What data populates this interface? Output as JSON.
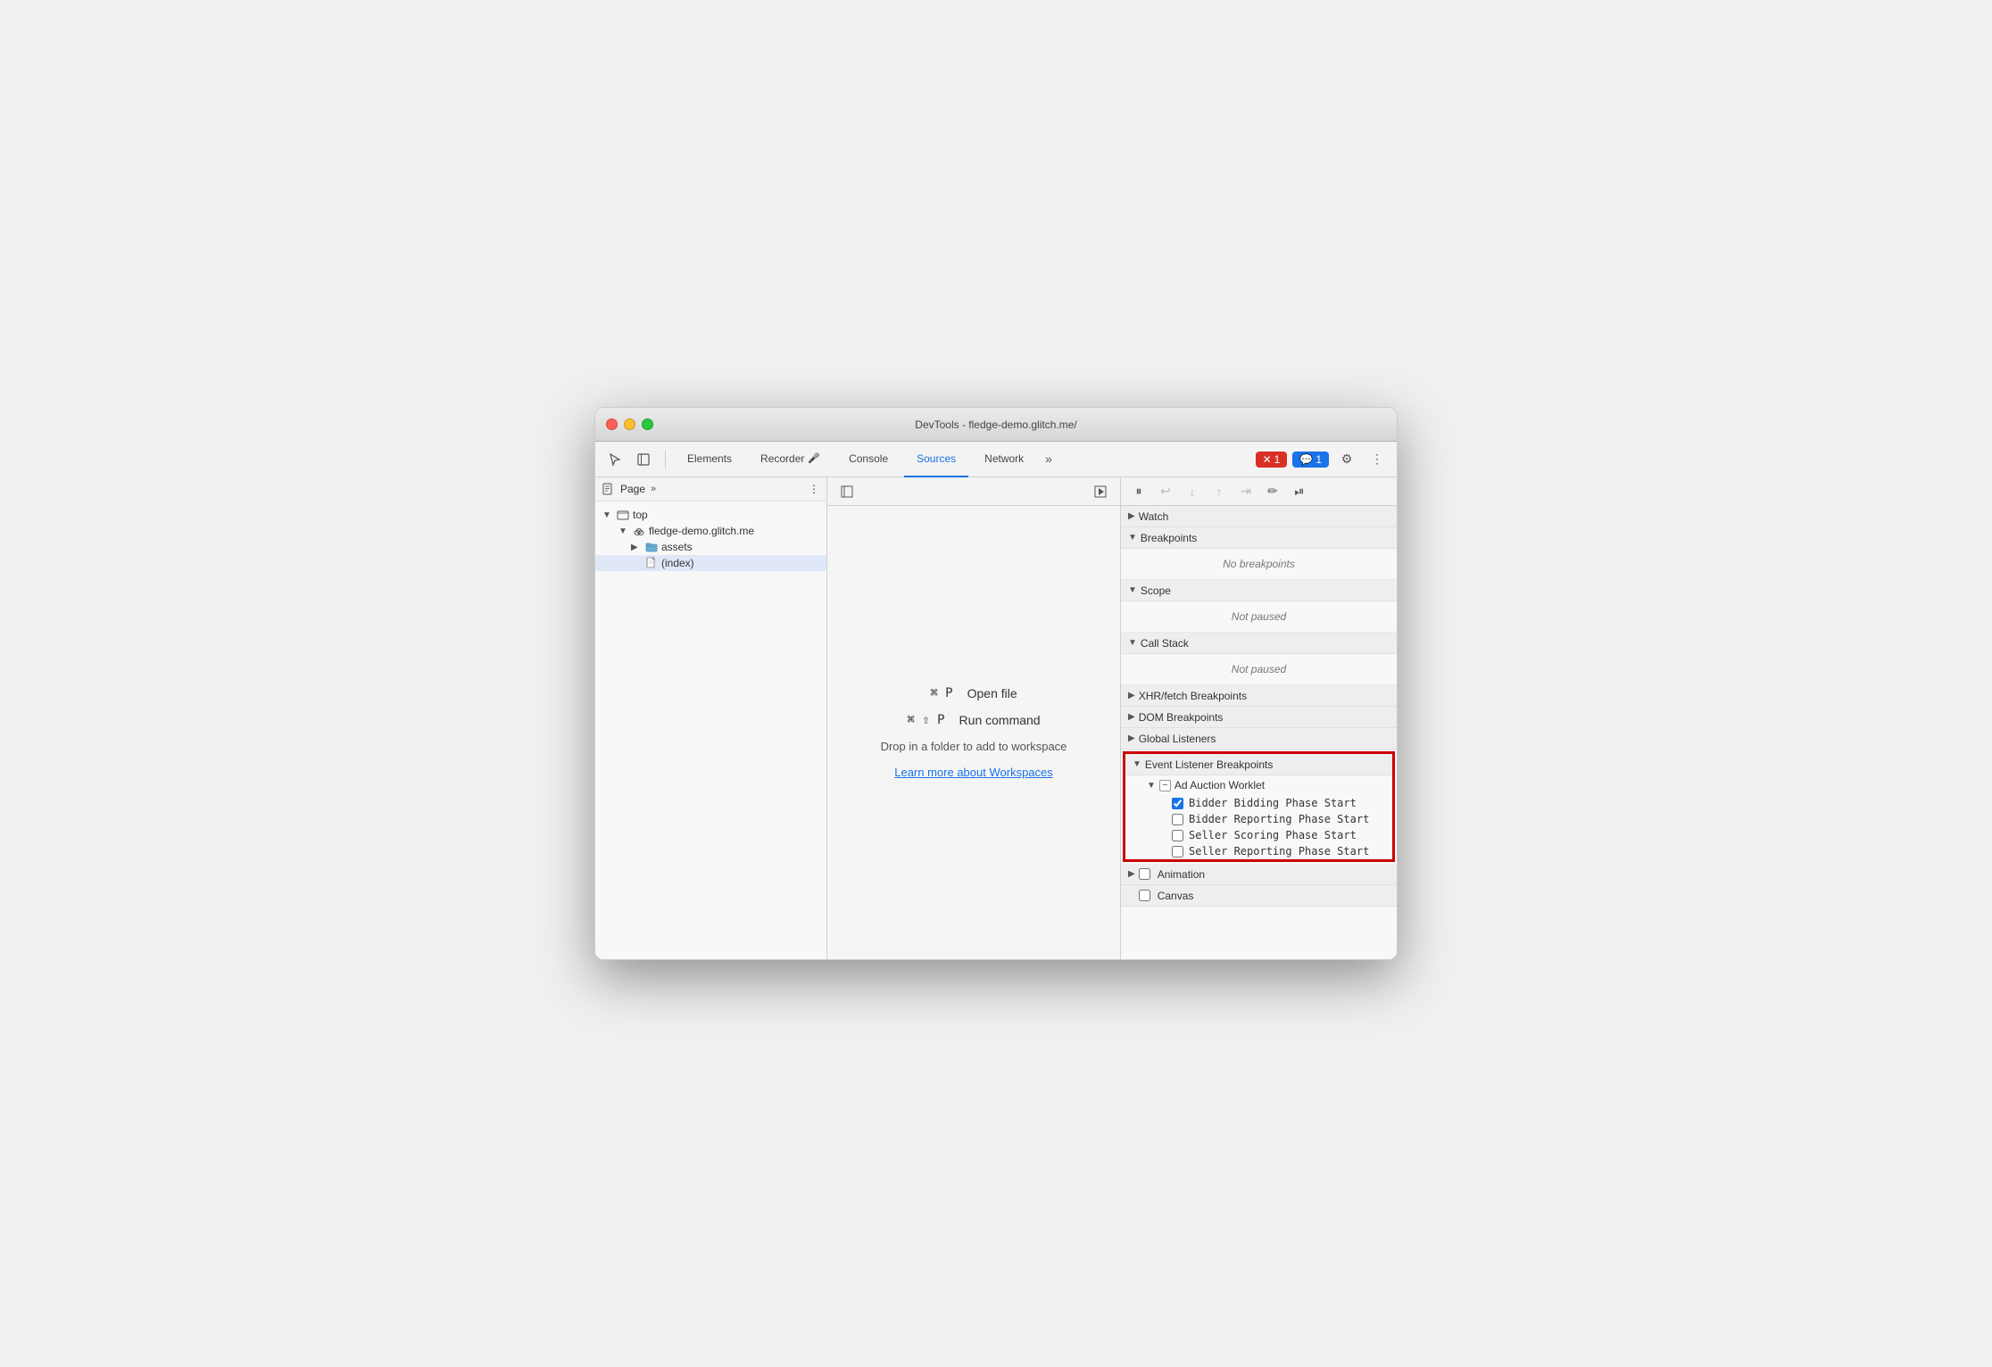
{
  "window": {
    "title": "DevTools - fledge-demo.glitch.me/"
  },
  "toolbar": {
    "tabs": [
      {
        "label": "Elements",
        "active": false
      },
      {
        "label": "Recorder",
        "active": false
      },
      {
        "label": "Console",
        "active": false
      },
      {
        "label": "Sources",
        "active": true
      },
      {
        "label": "Network",
        "active": false
      },
      {
        "label": "»",
        "active": false
      }
    ],
    "error_badge": "1",
    "message_badge": "1"
  },
  "left_panel": {
    "header": "Page",
    "tree": [
      {
        "label": "top",
        "indent": 0,
        "expanded": true,
        "type": "folder"
      },
      {
        "label": "fledge-demo.glitch.me",
        "indent": 1,
        "expanded": true,
        "type": "cloud"
      },
      {
        "label": "assets",
        "indent": 2,
        "expanded": false,
        "type": "folder"
      },
      {
        "label": "(index)",
        "indent": 2,
        "expanded": false,
        "type": "file",
        "selected": true
      }
    ]
  },
  "middle_panel": {
    "shortcut1": {
      "keys": "⌘ P",
      "label": "Open file"
    },
    "shortcut2": {
      "keys": "⌘ ⇧ P",
      "label": "Run command"
    },
    "drop_text": "Drop in a folder to add to workspace",
    "workspace_link": "Learn more about Workspaces"
  },
  "right_panel": {
    "sections": [
      {
        "label": "Watch",
        "expanded": false,
        "type": "collapsed"
      },
      {
        "label": "Breakpoints",
        "expanded": true,
        "content": "No breakpoints"
      },
      {
        "label": "Scope",
        "expanded": true,
        "content": "Not paused"
      },
      {
        "label": "Call Stack",
        "expanded": true,
        "content": "Not paused"
      },
      {
        "label": "XHR/fetch Breakpoints",
        "expanded": false,
        "type": "collapsed"
      },
      {
        "label": "DOM Breakpoints",
        "expanded": false,
        "type": "collapsed"
      },
      {
        "label": "Global Listeners",
        "expanded": false,
        "type": "collapsed"
      }
    ],
    "event_listener": {
      "label": "Event Listener Breakpoints",
      "sub_sections": [
        {
          "label": "Ad Auction Worklet",
          "checkboxes": [
            {
              "label": "Bidder Bidding Phase Start",
              "checked": true
            },
            {
              "label": "Bidder Reporting Phase Start",
              "checked": false
            },
            {
              "label": "Seller Scoring Phase Start",
              "checked": false
            },
            {
              "label": "Seller Reporting Phase Start",
              "checked": false
            }
          ]
        }
      ]
    },
    "after_sections": [
      {
        "label": "Animation"
      },
      {
        "label": "Canvas"
      }
    ]
  }
}
